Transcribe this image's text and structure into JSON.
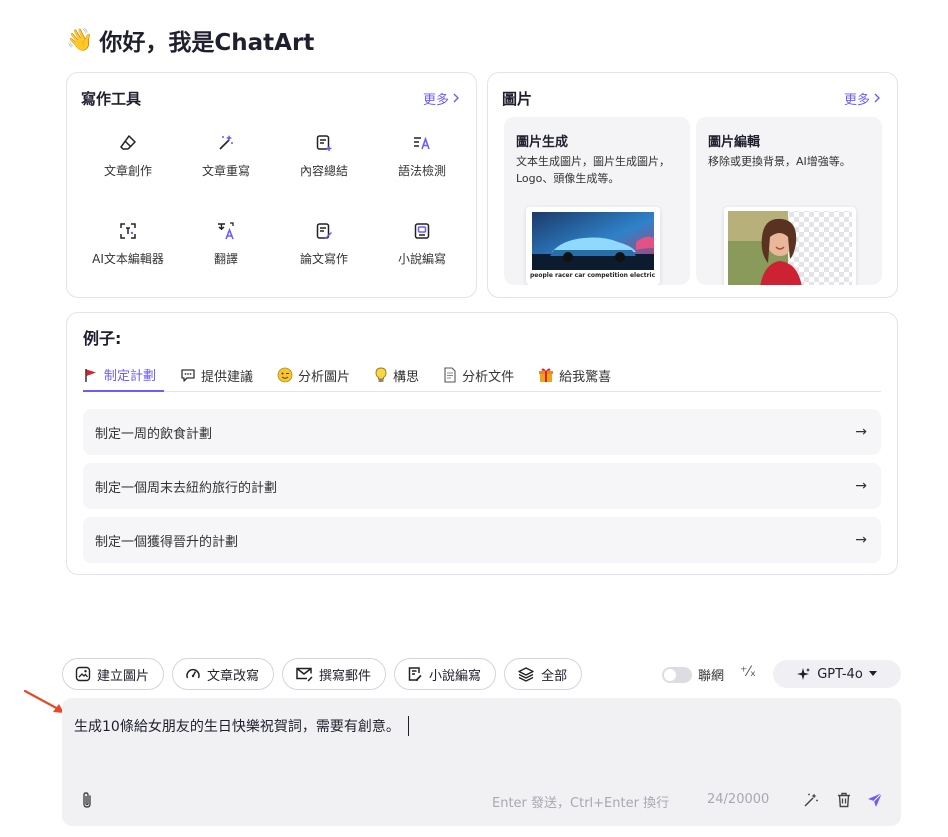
{
  "greeting": {
    "emoji": "👋",
    "text": "你好，我是ChatArt"
  },
  "writing_tools": {
    "title": "寫作工具",
    "more": "更多",
    "items": [
      {
        "label": "文章創作",
        "icon": "eraser-pen-icon"
      },
      {
        "label": "文章重寫",
        "icon": "magic-wand-icon"
      },
      {
        "label": "內容總結",
        "icon": "document-summary-icon"
      },
      {
        "label": "語法檢測",
        "icon": "grammar-check-icon"
      },
      {
        "label": "AI文本編輯器",
        "icon": "ai-text-editor-icon"
      },
      {
        "label": "翻譯",
        "icon": "translate-icon"
      },
      {
        "label": "論文寫作",
        "icon": "paper-pen-icon"
      },
      {
        "label": "小說編寫",
        "icon": "novel-icon"
      }
    ]
  },
  "images": {
    "title": "圖片",
    "more": "更多",
    "tiles": [
      {
        "title": "圖片生成",
        "desc": "文本生成圖片，圖片生成圖片，Logo、頭像生成等。",
        "caption": "people racer car competition electric car"
      },
      {
        "title": "圖片編輯",
        "desc": "移除或更換背景，AI增強等。"
      }
    ]
  },
  "examples": {
    "title": "例子:",
    "tabs": [
      {
        "label": "制定計劃",
        "icon": "flag-icon"
      },
      {
        "label": "提供建議",
        "icon": "chat-bubble-icon"
      },
      {
        "label": "分析圖片",
        "icon": "emoji-icon"
      },
      {
        "label": "構思",
        "icon": "lightbulb-icon"
      },
      {
        "label": "分析文件",
        "icon": "document-icon"
      },
      {
        "label": "給我驚喜",
        "icon": "gift-icon"
      }
    ],
    "rows": [
      "制定一周的飲食計劃",
      "制定一個周末去紐約旅行的計劃",
      "制定一個獲得晉升的計劃"
    ]
  },
  "chips": [
    {
      "label": "建立圖片",
      "icon": "image-icon"
    },
    {
      "label": "文章改寫",
      "icon": "speedometer-icon"
    },
    {
      "label": "撰寫郵件",
      "icon": "mail-icon"
    },
    {
      "label": "小說編寫",
      "icon": "novel-edit-icon"
    },
    {
      "label": "全部",
      "icon": "layers-icon"
    }
  ],
  "web_toggle": {
    "label": "聯網",
    "on": false
  },
  "prompt_symbol": "⁺⁄ₓ",
  "model": {
    "name": "GPT-4o"
  },
  "composer": {
    "text": "生成10條給女朋友的生日快樂祝賀詞，需要有創意。",
    "hint": "Enter 發送，Ctrl+Enter 換行",
    "count": "24/20000"
  },
  "colors": {
    "accent": "#6b5cff",
    "arrow": "#e8472a",
    "border": "#e3e3ea",
    "composer_bg": "#f1f1f4"
  }
}
